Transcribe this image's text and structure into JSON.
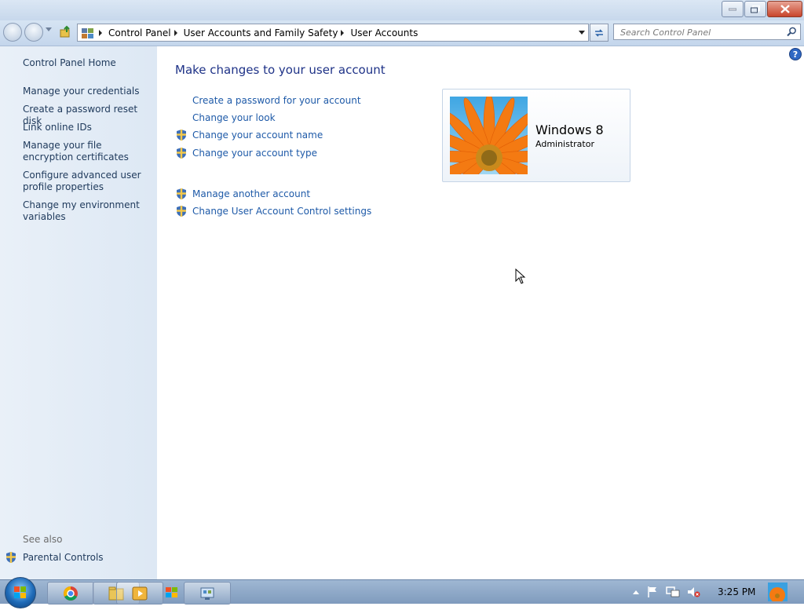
{
  "window": {
    "minimize_icon": "minimize-icon",
    "maximize_icon": "restore-icon",
    "close_icon": "close-icon"
  },
  "addressbar": {
    "crumbs": [
      "Control Panel",
      "User Accounts and Family Safety",
      "User Accounts"
    ],
    "search_placeholder": "Search Control Panel"
  },
  "sidebar": {
    "home": "Control Panel Home",
    "items": [
      "Manage your credentials",
      "Create a password reset disk",
      "Link online IDs",
      "Manage your file encryption certificates",
      "Configure advanced user profile properties",
      "Change my environment variables"
    ],
    "see_also": "See also",
    "parental": "Parental Controls"
  },
  "main": {
    "title": "Make changes to your user account",
    "links": [
      "Create a password for your account",
      "Change your look",
      "Change your account name",
      "Change your account type",
      "Manage another account",
      "Change User Account Control settings"
    ]
  },
  "account": {
    "name": "Windows 8",
    "role": "Administrator"
  },
  "taskbar": {
    "clock": "3:25 PM"
  },
  "colors": {
    "link": "#1e5aa8",
    "title": "#1e3287",
    "sidebar_bg": "#e3ecf6"
  }
}
